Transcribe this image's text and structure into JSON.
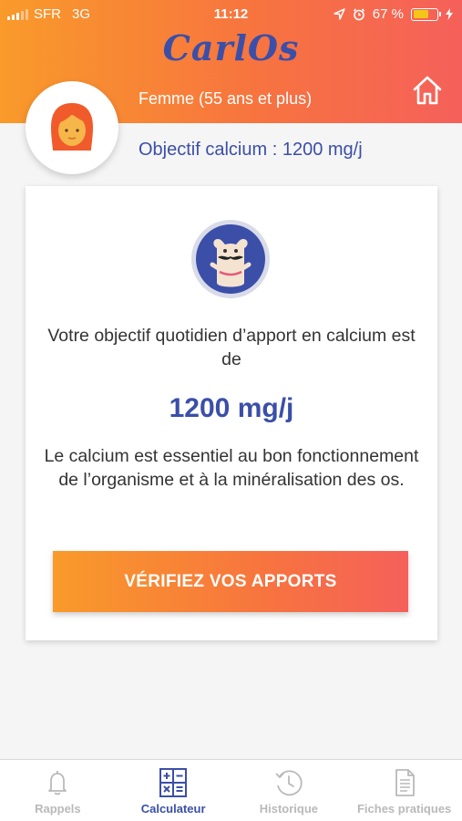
{
  "status_bar": {
    "carrier": "SFR",
    "network": "3G",
    "time": "11:12",
    "battery_percent": "67 %",
    "battery_level": 0.67
  },
  "app": {
    "logo_text_part1": "CarlO",
    "logo_text_part2": "s",
    "brand_color": "#3b4fa8",
    "gradient_start": "#f99a2a",
    "gradient_end": "#f5605a"
  },
  "profile": {
    "label": "Femme (55 ans et plus)",
    "objective": "Objectif calcium : 1200 mg/j"
  },
  "card": {
    "intro": "Votre objectif quotidien d’apport en calcium est de",
    "value": "1200 mg/j",
    "description": "Le calcium est essentiel au bon fonctionnement de l’organisme et à la minéralisation des os.",
    "cta_label": "VÉRIFIEZ VOS APPORTS"
  },
  "tabs": [
    {
      "label": "Rappels",
      "icon": "bell-icon",
      "active": false
    },
    {
      "label": "Calculateur",
      "icon": "calculator-icon",
      "active": true
    },
    {
      "label": "Historique",
      "icon": "history-icon",
      "active": false
    },
    {
      "label": "Fiches pratiques",
      "icon": "document-icon",
      "active": false
    }
  ]
}
